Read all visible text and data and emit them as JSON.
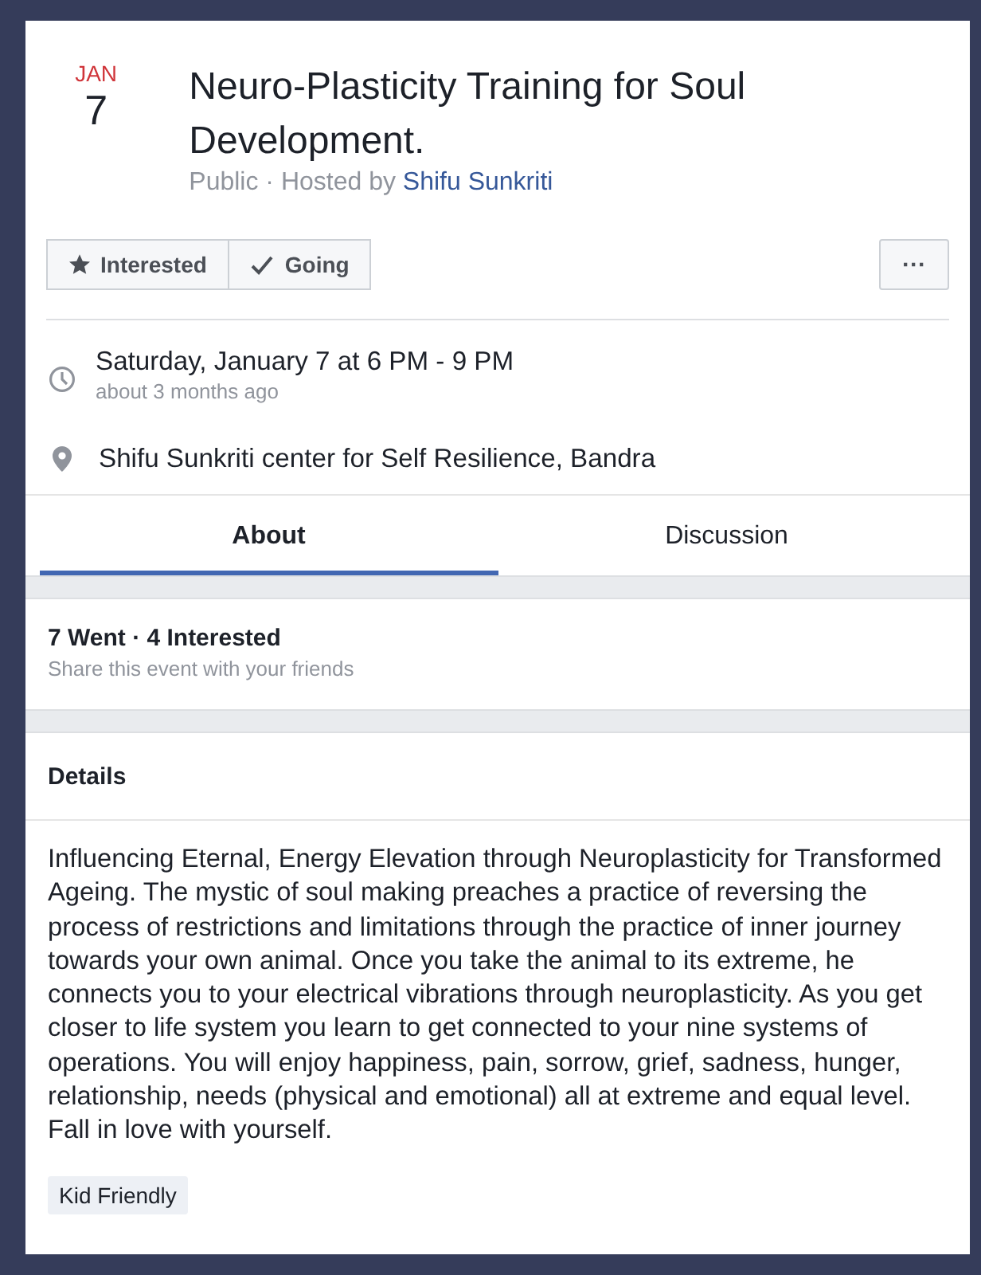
{
  "event": {
    "month": "JAN",
    "day": "7",
    "title": "Neuro-Plasticity Training for Soul Development.",
    "subtitle": "Public · Hosted by",
    "host": "Shifu Sunkriti"
  },
  "actions": [
    {
      "label": "Interested",
      "kind": "interested"
    },
    {
      "label": "Going",
      "kind": "going"
    }
  ],
  "more_button": {
    "label": "···"
  },
  "when": {
    "text": "Saturday, January 7 at 6 PM - 9 PM",
    "relative": "about 3 months ago"
  },
  "where": {
    "text": "Shifu Sunkriti center for Self Resilience, Bandra"
  },
  "tabs": [
    {
      "label": "About",
      "selected": true
    },
    {
      "label": "Discussion",
      "selected": false
    }
  ],
  "attendance": {
    "summary": "7 Went · 4 Interested",
    "hint": "Share this event with your friends"
  },
  "details": {
    "heading": "Details",
    "body": "Influencing Eternal, Energy Elevation through Neuroplasticity for Transformed Ageing. The mystic of soul making preaches a practice of reversing the process of restrictions and limitations through the practice of inner journey towards your own animal. Once you take the animal to its extreme, he connects you to your electrical vibrations through neuroplasticity. As you get closer to life system you learn to get connected to your nine systems of operations. You will enjoy happiness, pain, sorrow, grief, sadness, hunger, relationship, needs (physical and emotional) all at extreme and equal level. Fall in love with yourself.",
    "tags": [
      "Kid Friendly"
    ]
  }
}
